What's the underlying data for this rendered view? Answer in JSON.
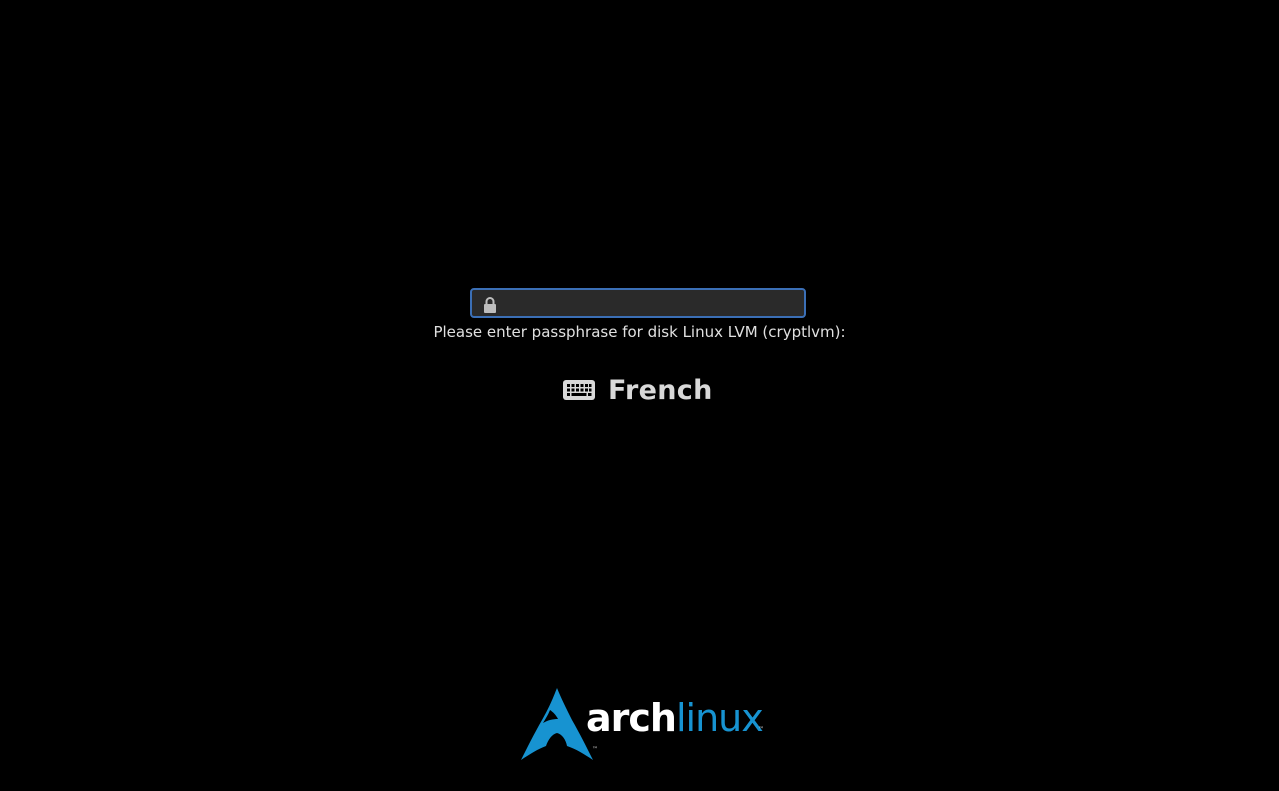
{
  "passphrase": {
    "value": "",
    "placeholder": "",
    "prompt": "Please enter passphrase for disk Linux LVM (cryptlvm):",
    "border_color": "#3b6fb6",
    "field_color": "#2a2a2a",
    "icon": "lock-icon"
  },
  "keyboard_layout": {
    "label": "French",
    "icon": "keyboard-icon"
  },
  "branding": {
    "logo_part1": "arch",
    "logo_part2": "linux",
    "trademark": "™",
    "accent_color": "#1793d1",
    "icon": "arch-linux-logo"
  }
}
